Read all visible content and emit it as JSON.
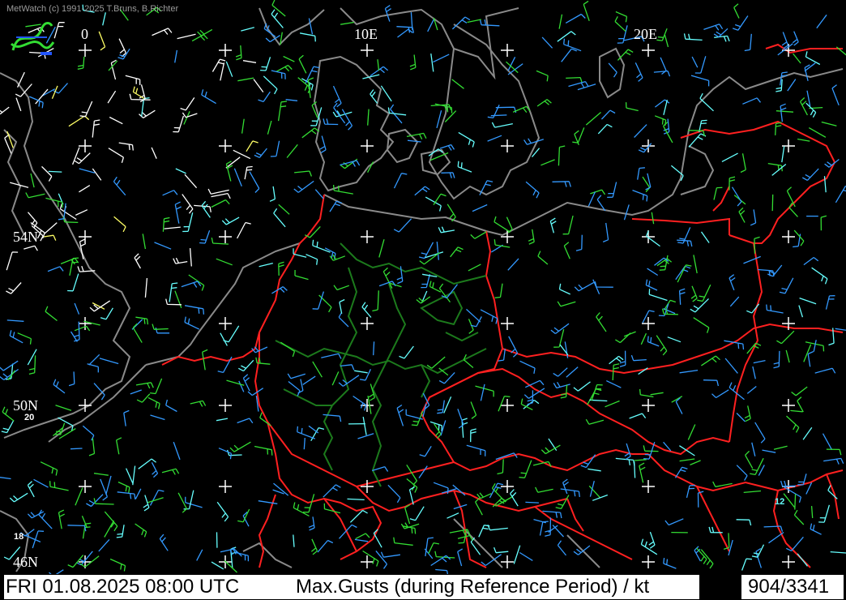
{
  "credit": "MetWatch  (c) 1991-2025 T.Bruns, B.Richter",
  "longitude_labels": [
    "0",
    "10E",
    "20E"
  ],
  "latitude_labels": [
    "54N",
    "50N",
    "46N"
  ],
  "station_values": [
    {
      "text": "20",
      "color": "#ffffff"
    },
    {
      "text": "18",
      "color": "#ffffff"
    },
    {
      "text": "12",
      "color": "#66ffff"
    }
  ],
  "footer": {
    "datetime": "FRI 01.08.2025 08:00 UTC",
    "title": "Max.Gusts (during Reference Period) / kt",
    "count": "904/3341"
  },
  "colors": {
    "background": "#000000",
    "coastline": "#8a8a8a",
    "borders": "#ff2020",
    "german_states": "#1c7a1c",
    "grid_cross": "#ffffff",
    "wind_low": "#3399ff",
    "wind_mid": "#33dd33",
    "wind_cyan": "#66ffff",
    "wind_high": "#ffffff",
    "wind_yellow": "#ffff66"
  },
  "icons": [
    "metwatch-logo-icon"
  ]
}
